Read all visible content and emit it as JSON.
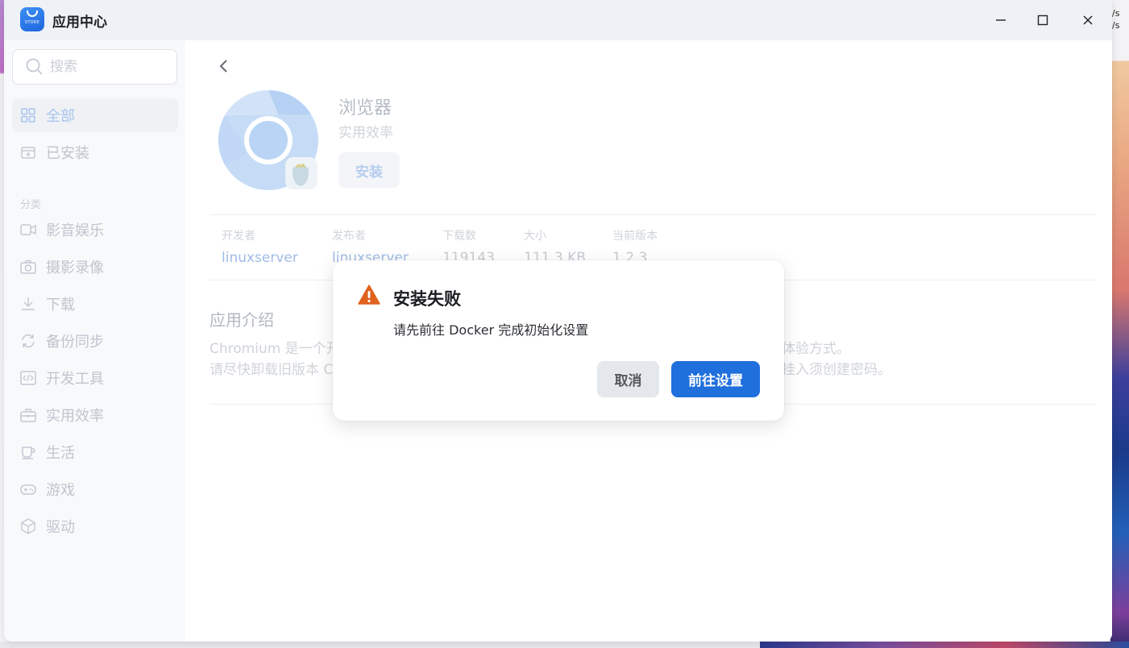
{
  "window": {
    "title": "应用中心",
    "icon_text": "STORE"
  },
  "desktop": {
    "speed_lines": [
      "/s",
      "/s"
    ]
  },
  "sidebar": {
    "search_placeholder": "搜索",
    "top_items": [
      {
        "label": "全部",
        "icon": "grid-icon",
        "active": true
      },
      {
        "label": "已安装",
        "icon": "install-box-icon",
        "active": false
      }
    ],
    "section_label": "分类",
    "categories": [
      {
        "label": "影音娱乐",
        "icon": "video-icon"
      },
      {
        "label": "摄影录像",
        "icon": "camera-icon"
      },
      {
        "label": "下载",
        "icon": "download-icon"
      },
      {
        "label": "备份同步",
        "icon": "sync-icon"
      },
      {
        "label": "开发工具",
        "icon": "code-icon"
      },
      {
        "label": "实用效率",
        "icon": "toolbox-icon"
      },
      {
        "label": "生活",
        "icon": "cup-icon"
      },
      {
        "label": "游戏",
        "icon": "gamepad-icon"
      },
      {
        "label": "驱动",
        "icon": "cube-icon"
      }
    ]
  },
  "app_detail": {
    "name": "浏览器",
    "category": "实用效率",
    "install_label": "安装",
    "meta": [
      {
        "key": "开发者",
        "value": "linuxserver",
        "link": true
      },
      {
        "key": "发布者",
        "value": "linuxserver",
        "link": true
      },
      {
        "key": "下载数",
        "value": "119143",
        "link": false
      },
      {
        "key": "大小",
        "value": "111.3 KB",
        "link": false
      },
      {
        "key": "当前版本",
        "value": "1.2.3",
        "link": false
      }
    ],
    "intro_title": "应用介绍",
    "intro_lines_left": [
      "Chromium 是一个开",
      "请尽快卸载旧版本 Cl"
    ],
    "intro_lines_right": [
      "体验方式。",
      "挂入须创建密码。"
    ]
  },
  "dialog": {
    "title": "安装失败",
    "message": "请先前往 Docker 完成初始化设置",
    "cancel_label": "取消",
    "confirm_label": "前往设置",
    "warn_color": "#e0621e",
    "confirm_color": "#1f6fdd"
  }
}
